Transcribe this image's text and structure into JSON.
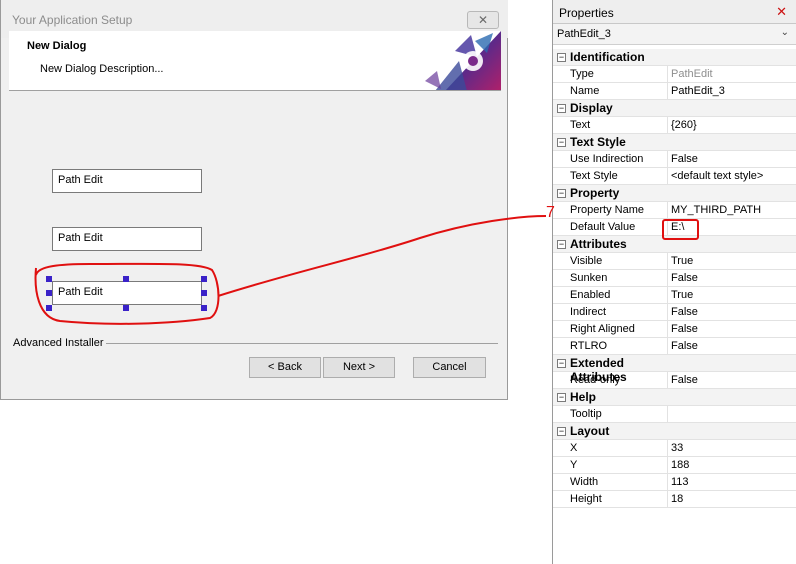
{
  "dialog": {
    "title": "Your Application Setup",
    "close_glyph": "✕",
    "header_title": "New Dialog",
    "header_description": "New Dialog Description...",
    "path_edits": [
      "Path Edit",
      "Path Edit",
      "Path Edit"
    ],
    "footer_brand": "Advanced Installer",
    "buttons": {
      "back": "< Back",
      "next": "Next >",
      "cancel": "Cancel"
    }
  },
  "properties": {
    "panel_title": "Properties",
    "close_glyph": "✕",
    "selected_control": "PathEdit_3",
    "dropdown_icon": "chevron-down-icon",
    "categories": [
      {
        "name": "Identification",
        "rows": [
          {
            "key": "Type",
            "value": "PathEdit"
          },
          {
            "key": "Name",
            "value": "PathEdit_3"
          }
        ]
      },
      {
        "name": "Display",
        "rows": [
          {
            "key": "Text",
            "value": "{260}"
          }
        ]
      },
      {
        "name": "Text Style",
        "rows": [
          {
            "key": "Use Indirection",
            "value": "False"
          },
          {
            "key": "Text Style",
            "value": "<default text style>"
          }
        ]
      },
      {
        "name": "Property",
        "rows": [
          {
            "key": "Property Name",
            "value": "MY_THIRD_PATH"
          },
          {
            "key": "Default Value",
            "value": "E:\\"
          }
        ]
      },
      {
        "name": "Attributes",
        "rows": [
          {
            "key": "Visible",
            "value": "True"
          },
          {
            "key": "Sunken",
            "value": "False"
          },
          {
            "key": "Enabled",
            "value": "True"
          },
          {
            "key": "Indirect",
            "value": "False"
          },
          {
            "key": "Right Aligned",
            "value": "False"
          },
          {
            "key": "RTLRO",
            "value": "False"
          }
        ]
      },
      {
        "name": "Extended Attributes",
        "rows": [
          {
            "key": "Read-only",
            "value": "False"
          }
        ]
      },
      {
        "name": "Help",
        "rows": [
          {
            "key": "Tooltip",
            "value": ""
          }
        ]
      },
      {
        "name": "Layout",
        "rows": [
          {
            "key": "X",
            "value": "33"
          },
          {
            "key": "Y",
            "value": "188"
          },
          {
            "key": "Width",
            "value": "113"
          },
          {
            "key": "Height",
            "value": "18"
          }
        ]
      }
    ]
  },
  "annotation": {
    "color": "#e01010",
    "label": "7"
  }
}
